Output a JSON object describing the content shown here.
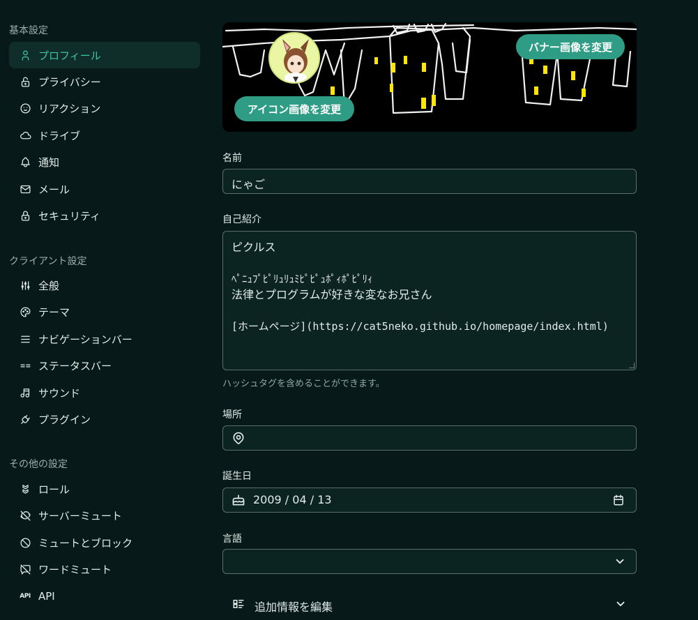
{
  "sidebar": {
    "sections": [
      {
        "title": "基本設定",
        "items": [
          {
            "label": "プロフィール",
            "icon": "user-icon",
            "active": true
          },
          {
            "label": "プライバシー",
            "icon": "lock-open-icon"
          },
          {
            "label": "リアクション",
            "icon": "mood-smile-icon"
          },
          {
            "label": "ドライブ",
            "icon": "cloud-icon"
          },
          {
            "label": "通知",
            "icon": "bell-icon"
          },
          {
            "label": "メール",
            "icon": "mail-icon"
          },
          {
            "label": "セキュリティ",
            "icon": "lock-icon"
          }
        ]
      },
      {
        "title": "クライアント設定",
        "items": [
          {
            "label": "全般",
            "icon": "adjustments-icon"
          },
          {
            "label": "テーマ",
            "icon": "palette-icon"
          },
          {
            "label": "ナビゲーションバー",
            "icon": "menu-icon"
          },
          {
            "label": "ステータスバー",
            "icon": "equal-icon"
          },
          {
            "label": "サウンド",
            "icon": "music-icon"
          },
          {
            "label": "プラグイン",
            "icon": "plug-icon"
          }
        ]
      },
      {
        "title": "その他の設定",
        "items": [
          {
            "label": "ロール",
            "icon": "badges-icon"
          },
          {
            "label": "サーバーミュート",
            "icon": "planet-off-icon"
          },
          {
            "label": "ミュートとブロック",
            "icon": "ban-icon"
          },
          {
            "label": "ワードミュート",
            "icon": "message-off-icon"
          },
          {
            "label": "API",
            "icon": "api-icon"
          }
        ]
      }
    ]
  },
  "profile": {
    "banner_button": "バナー画像を変更",
    "icon_button": "アイコン画像を変更",
    "name_label": "名前",
    "name_value": "にゃご",
    "bio_label": "自己紹介",
    "bio_lines": [
      "ピクルス",
      "",
      "ﾍﾟﾆｭﾌﾟﾋﾟﾘｭﾘｭﾐﾋﾟﾋﾟｭﾎﾟｨﾎﾟﾋﾟﾘｨ",
      "法律とプログラムが好きな変なお兄さん",
      "",
      "[ホームページ](https://cat5neko.github.io/homepage/index.html)"
    ],
    "bio_hint": "ハッシュタグを含めることができます。",
    "location_label": "場所",
    "location_value": "",
    "birthday_label": "誕生日",
    "birthday_value": "2009 / 04 / 13",
    "language_label": "言語",
    "language_value": "",
    "extra_label": "追加情報を編集"
  },
  "colors": {
    "accent": "#3fc7a4",
    "pill": "#2f9c85",
    "background": "#071a19"
  }
}
